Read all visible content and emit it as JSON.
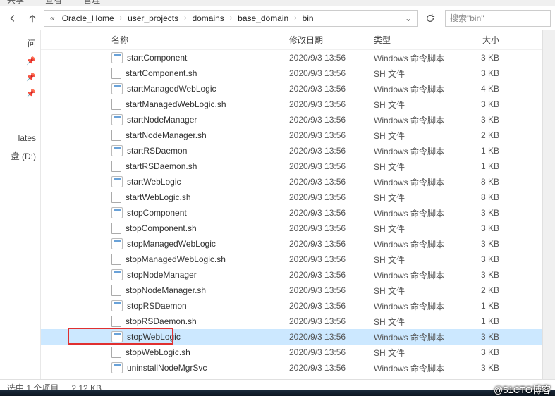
{
  "tabs": {
    "t1": "共享",
    "t2": "查看",
    "t3": "管理"
  },
  "breadcrumb": {
    "overflow": "«",
    "parts": [
      "Oracle_Home",
      "user_projects",
      "domains",
      "base_domain",
      "bin"
    ]
  },
  "search": {
    "placeholder": "搜索\"bin\""
  },
  "sidebar_left": {
    "i0": "问",
    "i1": "*",
    "i4": "lates",
    "i5": "盘 (D:)"
  },
  "columns": {
    "name": "名称",
    "date": "修改日期",
    "type": "类型",
    "size": "大小"
  },
  "types": {
    "cmd": "Windows 命令脚本",
    "sh": "SH 文件"
  },
  "date": "2020/9/3 13:56",
  "files": [
    {
      "icon": "cmd",
      "name": "startComponent",
      "type": "cmd",
      "size": "3 KB"
    },
    {
      "icon": "sh",
      "name": "startComponent.sh",
      "type": "sh",
      "size": "3 KB"
    },
    {
      "icon": "cmd",
      "name": "startManagedWebLogic",
      "type": "cmd",
      "size": "4 KB"
    },
    {
      "icon": "sh",
      "name": "startManagedWebLogic.sh",
      "type": "sh",
      "size": "3 KB"
    },
    {
      "icon": "cmd",
      "name": "startNodeManager",
      "type": "cmd",
      "size": "3 KB"
    },
    {
      "icon": "sh",
      "name": "startNodeManager.sh",
      "type": "sh",
      "size": "2 KB"
    },
    {
      "icon": "cmd",
      "name": "startRSDaemon",
      "type": "cmd",
      "size": "1 KB"
    },
    {
      "icon": "sh",
      "name": "startRSDaemon.sh",
      "type": "sh",
      "size": "1 KB"
    },
    {
      "icon": "cmd",
      "name": "startWebLogic",
      "type": "cmd",
      "size": "8 KB"
    },
    {
      "icon": "sh",
      "name": "startWebLogic.sh",
      "type": "sh",
      "size": "8 KB"
    },
    {
      "icon": "cmd",
      "name": "stopComponent",
      "type": "cmd",
      "size": "3 KB"
    },
    {
      "icon": "sh",
      "name": "stopComponent.sh",
      "type": "sh",
      "size": "3 KB"
    },
    {
      "icon": "cmd",
      "name": "stopManagedWebLogic",
      "type": "cmd",
      "size": "3 KB"
    },
    {
      "icon": "sh",
      "name": "stopManagedWebLogic.sh",
      "type": "sh",
      "size": "3 KB"
    },
    {
      "icon": "cmd",
      "name": "stopNodeManager",
      "type": "cmd",
      "size": "3 KB"
    },
    {
      "icon": "sh",
      "name": "stopNodeManager.sh",
      "type": "sh",
      "size": "2 KB"
    },
    {
      "icon": "cmd",
      "name": "stopRSDaemon",
      "type": "cmd",
      "size": "1 KB"
    },
    {
      "icon": "sh",
      "name": "stopRSDaemon.sh",
      "type": "sh",
      "size": "1 KB"
    },
    {
      "icon": "cmd",
      "name": "stopWebLogic",
      "type": "cmd",
      "size": "3 KB",
      "selected": true
    },
    {
      "icon": "sh",
      "name": "stopWebLogic.sh",
      "type": "sh",
      "size": "3 KB"
    },
    {
      "icon": "cmd",
      "name": "uninstallNodeMgrSvc",
      "type": "cmd",
      "size": "3 KB"
    }
  ],
  "status": {
    "selected": "选中 1 个项目",
    "size": "2.12 KB"
  },
  "watermark": "@51CTO博客",
  "highlight_row_index": 18
}
